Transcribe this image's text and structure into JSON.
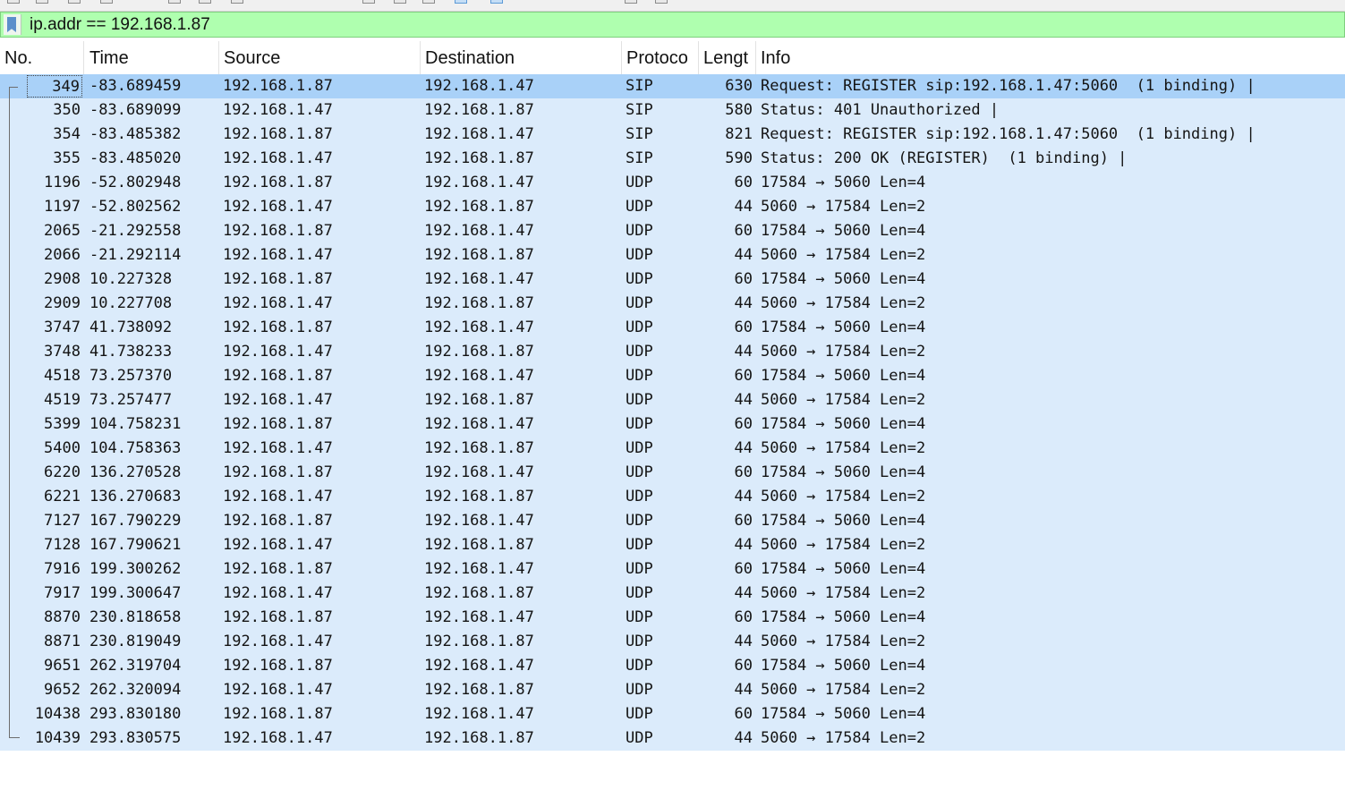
{
  "filter": {
    "value": "ip.addr == 192.168.1.87",
    "bookmark_icon": "bookmark-icon",
    "background_color": "#afffaf"
  },
  "columns": {
    "no": "No.",
    "time": "Time",
    "source": "Source",
    "destination": "Destination",
    "protocol": "Protoco",
    "length": "Lengt",
    "info": "Info"
  },
  "colors": {
    "row_background": "#dbebfb",
    "selected_row": "#a9d1f8"
  },
  "packets": [
    {
      "no": "349",
      "time": "-83.689459",
      "src": "192.168.1.87",
      "dst": "192.168.1.47",
      "proto": "SIP",
      "len": "630",
      "info": "Request: REGISTER sip:192.168.1.47:5060  (1 binding) |",
      "selected": true
    },
    {
      "no": "350",
      "time": "-83.689099",
      "src": "192.168.1.47",
      "dst": "192.168.1.87",
      "proto": "SIP",
      "len": "580",
      "info": "Status: 401 Unauthorized |"
    },
    {
      "no": "354",
      "time": "-83.485382",
      "src": "192.168.1.87",
      "dst": "192.168.1.47",
      "proto": "SIP",
      "len": "821",
      "info": "Request: REGISTER sip:192.168.1.47:5060  (1 binding) |"
    },
    {
      "no": "355",
      "time": "-83.485020",
      "src": "192.168.1.47",
      "dst": "192.168.1.87",
      "proto": "SIP",
      "len": "590",
      "info": "Status: 200 OK (REGISTER)  (1 binding) |"
    },
    {
      "no": "1196",
      "time": "-52.802948",
      "src": "192.168.1.87",
      "dst": "192.168.1.47",
      "proto": "UDP",
      "len": "60",
      "info": "17584 → 5060 Len=4"
    },
    {
      "no": "1197",
      "time": "-52.802562",
      "src": "192.168.1.47",
      "dst": "192.168.1.87",
      "proto": "UDP",
      "len": "44",
      "info": "5060 → 17584 Len=2"
    },
    {
      "no": "2065",
      "time": "-21.292558",
      "src": "192.168.1.87",
      "dst": "192.168.1.47",
      "proto": "UDP",
      "len": "60",
      "info": "17584 → 5060 Len=4"
    },
    {
      "no": "2066",
      "time": "-21.292114",
      "src": "192.168.1.47",
      "dst": "192.168.1.87",
      "proto": "UDP",
      "len": "44",
      "info": "5060 → 17584 Len=2"
    },
    {
      "no": "2908",
      "time": "10.227328",
      "src": "192.168.1.87",
      "dst": "192.168.1.47",
      "proto": "UDP",
      "len": "60",
      "info": "17584 → 5060 Len=4"
    },
    {
      "no": "2909",
      "time": "10.227708",
      "src": "192.168.1.47",
      "dst": "192.168.1.87",
      "proto": "UDP",
      "len": "44",
      "info": "5060 → 17584 Len=2"
    },
    {
      "no": "3747",
      "time": "41.738092",
      "src": "192.168.1.87",
      "dst": "192.168.1.47",
      "proto": "UDP",
      "len": "60",
      "info": "17584 → 5060 Len=4"
    },
    {
      "no": "3748",
      "time": "41.738233",
      "src": "192.168.1.47",
      "dst": "192.168.1.87",
      "proto": "UDP",
      "len": "44",
      "info": "5060 → 17584 Len=2"
    },
    {
      "no": "4518",
      "time": "73.257370",
      "src": "192.168.1.87",
      "dst": "192.168.1.47",
      "proto": "UDP",
      "len": "60",
      "info": "17584 → 5060 Len=4"
    },
    {
      "no": "4519",
      "time": "73.257477",
      "src": "192.168.1.47",
      "dst": "192.168.1.87",
      "proto": "UDP",
      "len": "44",
      "info": "5060 → 17584 Len=2"
    },
    {
      "no": "5399",
      "time": "104.758231",
      "src": "192.168.1.87",
      "dst": "192.168.1.47",
      "proto": "UDP",
      "len": "60",
      "info": "17584 → 5060 Len=4"
    },
    {
      "no": "5400",
      "time": "104.758363",
      "src": "192.168.1.47",
      "dst": "192.168.1.87",
      "proto": "UDP",
      "len": "44",
      "info": "5060 → 17584 Len=2"
    },
    {
      "no": "6220",
      "time": "136.270528",
      "src": "192.168.1.87",
      "dst": "192.168.1.47",
      "proto": "UDP",
      "len": "60",
      "info": "17584 → 5060 Len=4"
    },
    {
      "no": "6221",
      "time": "136.270683",
      "src": "192.168.1.47",
      "dst": "192.168.1.87",
      "proto": "UDP",
      "len": "44",
      "info": "5060 → 17584 Len=2"
    },
    {
      "no": "7127",
      "time": "167.790229",
      "src": "192.168.1.87",
      "dst": "192.168.1.47",
      "proto": "UDP",
      "len": "60",
      "info": "17584 → 5060 Len=4"
    },
    {
      "no": "7128",
      "time": "167.790621",
      "src": "192.168.1.47",
      "dst": "192.168.1.87",
      "proto": "UDP",
      "len": "44",
      "info": "5060 → 17584 Len=2"
    },
    {
      "no": "7916",
      "time": "199.300262",
      "src": "192.168.1.87",
      "dst": "192.168.1.47",
      "proto": "UDP",
      "len": "60",
      "info": "17584 → 5060 Len=4"
    },
    {
      "no": "7917",
      "time": "199.300647",
      "src": "192.168.1.47",
      "dst": "192.168.1.87",
      "proto": "UDP",
      "len": "44",
      "info": "5060 → 17584 Len=2"
    },
    {
      "no": "8870",
      "time": "230.818658",
      "src": "192.168.1.87",
      "dst": "192.168.1.47",
      "proto": "UDP",
      "len": "60",
      "info": "17584 → 5060 Len=4"
    },
    {
      "no": "8871",
      "time": "230.819049",
      "src": "192.168.1.47",
      "dst": "192.168.1.87",
      "proto": "UDP",
      "len": "44",
      "info": "5060 → 17584 Len=2"
    },
    {
      "no": "9651",
      "time": "262.319704",
      "src": "192.168.1.87",
      "dst": "192.168.1.47",
      "proto": "UDP",
      "len": "60",
      "info": "17584 → 5060 Len=4"
    },
    {
      "no": "9652",
      "time": "262.320094",
      "src": "192.168.1.47",
      "dst": "192.168.1.87",
      "proto": "UDP",
      "len": "44",
      "info": "5060 → 17584 Len=2"
    },
    {
      "no": "10438",
      "time": "293.830180",
      "src": "192.168.1.87",
      "dst": "192.168.1.47",
      "proto": "UDP",
      "len": "60",
      "info": "17584 → 5060 Len=4"
    },
    {
      "no": "10439",
      "time": "293.830575",
      "src": "192.168.1.47",
      "dst": "192.168.1.87",
      "proto": "UDP",
      "len": "44",
      "info": "5060 → 17584 Len=2"
    }
  ]
}
